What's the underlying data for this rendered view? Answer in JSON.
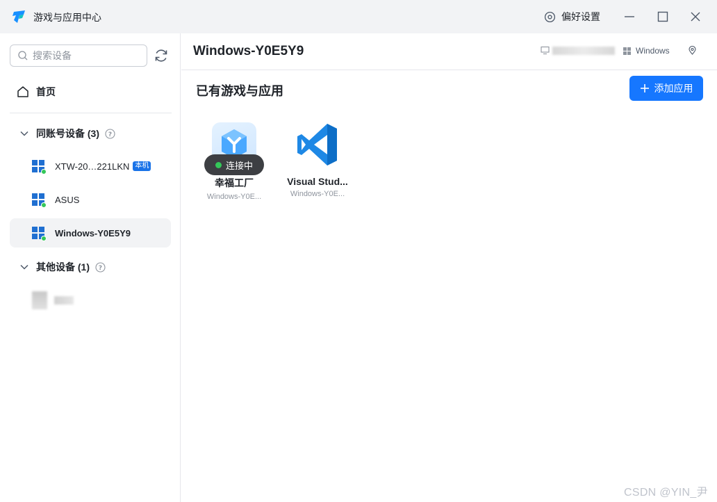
{
  "titlebar": {
    "app_title": "游戏与应用中心",
    "preferences_label": "偏好设置",
    "icons": [
      "app-logo-icon",
      "settings-icon",
      "minimize-icon",
      "maximize-icon",
      "close-icon"
    ]
  },
  "sidebar": {
    "search_placeholder": "搜索设备",
    "home_label": "首页",
    "groups": [
      {
        "label": "同账号设备 (3)",
        "expanded": true,
        "devices": [
          {
            "name": "XTW-20…221LKN",
            "badge": "本机",
            "online": true,
            "selected": false
          },
          {
            "name": "ASUS",
            "online": true,
            "selected": false
          },
          {
            "name": "Windows-Y0E5Y9",
            "online": true,
            "selected": true
          }
        ]
      },
      {
        "label": "其他设备 (1)",
        "expanded": true,
        "devices": []
      }
    ]
  },
  "main": {
    "device_title": "Windows-Y0E5Y9",
    "os_label": "Windows",
    "section_title": "已有游戏与应用",
    "add_button_label": "添加应用",
    "apps": [
      {
        "name": "幸福工厂",
        "device": "Windows-Y0E...",
        "status": "连接中"
      },
      {
        "name": "Visual Stud...",
        "device": "Windows-Y0E..."
      }
    ]
  },
  "watermark": "CSDN @YIN_尹",
  "colors": {
    "accent": "#1677ff",
    "online": "#34c759",
    "titlebar_bg": "#f2f3f5",
    "selected_bg": "#f2f3f5",
    "badge": "#1a73e8"
  }
}
